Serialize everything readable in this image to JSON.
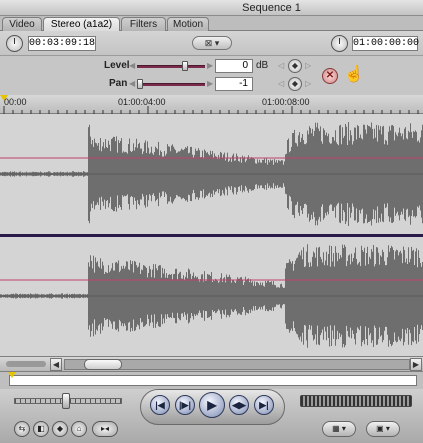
{
  "window": {
    "title": "Sequence 1"
  },
  "tabs": [
    {
      "label": "Video"
    },
    {
      "label": "Stereo (a1a2)",
      "active": true
    },
    {
      "label": "Filters"
    },
    {
      "label": "Motion"
    }
  ],
  "toolbar": {
    "duration_timecode": "00:03:09:18",
    "current_timecode": "01:00:00:00",
    "center_button_icon": "filmstrip-icon"
  },
  "params": {
    "level": {
      "label": "Level",
      "value": "0",
      "unit": "dB",
      "slider_fraction": 0.72
    },
    "pan": {
      "label": "Pan",
      "value": "-1",
      "slider_fraction": 0.0
    },
    "reset_icon": "x-icon"
  },
  "ruler": {
    "ticks": [
      "00:00",
      "01:00:04:00",
      "01:00:08:00"
    ]
  },
  "colors": {
    "waveform": "#6e6e6e",
    "level_line": "#c0406a",
    "pan_line": "#c0406a",
    "channel_divider": "#2a1a4a",
    "playhead": "#e6c400"
  },
  "transport": {
    "buttons": [
      {
        "name": "go-to-previous-edit-icon"
      },
      {
        "name": "play-in-to-out-icon"
      },
      {
        "name": "play-icon"
      },
      {
        "name": "play-around-current-icon"
      },
      {
        "name": "go-to-next-edit-icon"
      }
    ],
    "shuttle_fraction": 0.5
  },
  "bottom_buttons": [
    {
      "name": "match-frame-icon"
    },
    {
      "name": "mark-clip-icon"
    },
    {
      "name": "add-keyframe-icon"
    },
    {
      "name": "add-marker-icon"
    },
    {
      "name": "mark-in-out-icon"
    }
  ]
}
